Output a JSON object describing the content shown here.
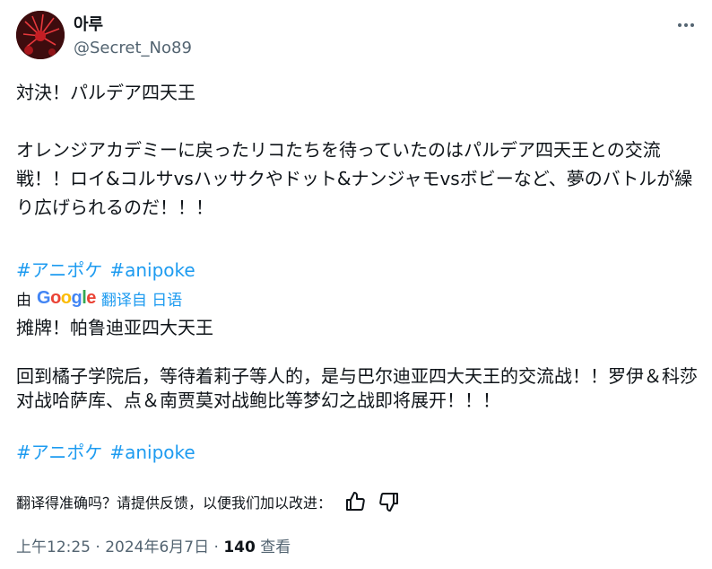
{
  "author": {
    "name": "아루",
    "handle": "@Secret_No89"
  },
  "tweet": {
    "text_line1": "対決！パルデア四天王",
    "text_paragraph": "オレンジアカデミーに戻ったリコたちを待っていたのはパルデア四天王との交流戦！！ロイ&コルサvsハッサクやドット&ナンジャモvsボビーなど、夢のバトルが繰り広げられるのだ！！！",
    "hashtags": [
      "#アニポケ",
      "#anipoke"
    ]
  },
  "translation": {
    "prefix": "由",
    "provider": "Google",
    "link_label": "翻译自 日语",
    "line1": "摊牌！帕鲁迪亚四大天王",
    "paragraph": "回到橘子学院后，等待着莉子等人的，是与巴尔迪亚四大天王的交流战！！罗伊＆科莎对战哈萨库、点＆南贾莫对战鲍比等梦幻之战即将展开！！！",
    "hashtags": [
      "#アニポケ",
      "#anipoke"
    ]
  },
  "feedback": {
    "question": "翻译得准确吗？请提供反馈，以便我们加以改进："
  },
  "meta": {
    "time": "上午12:25",
    "date": "2024年6月7日",
    "views_count": "140",
    "views_label": "查看",
    "separator": "·"
  },
  "colors": {
    "link": "#1d9bf0",
    "secondary": "#536471",
    "primary_text": "#0f1419"
  }
}
